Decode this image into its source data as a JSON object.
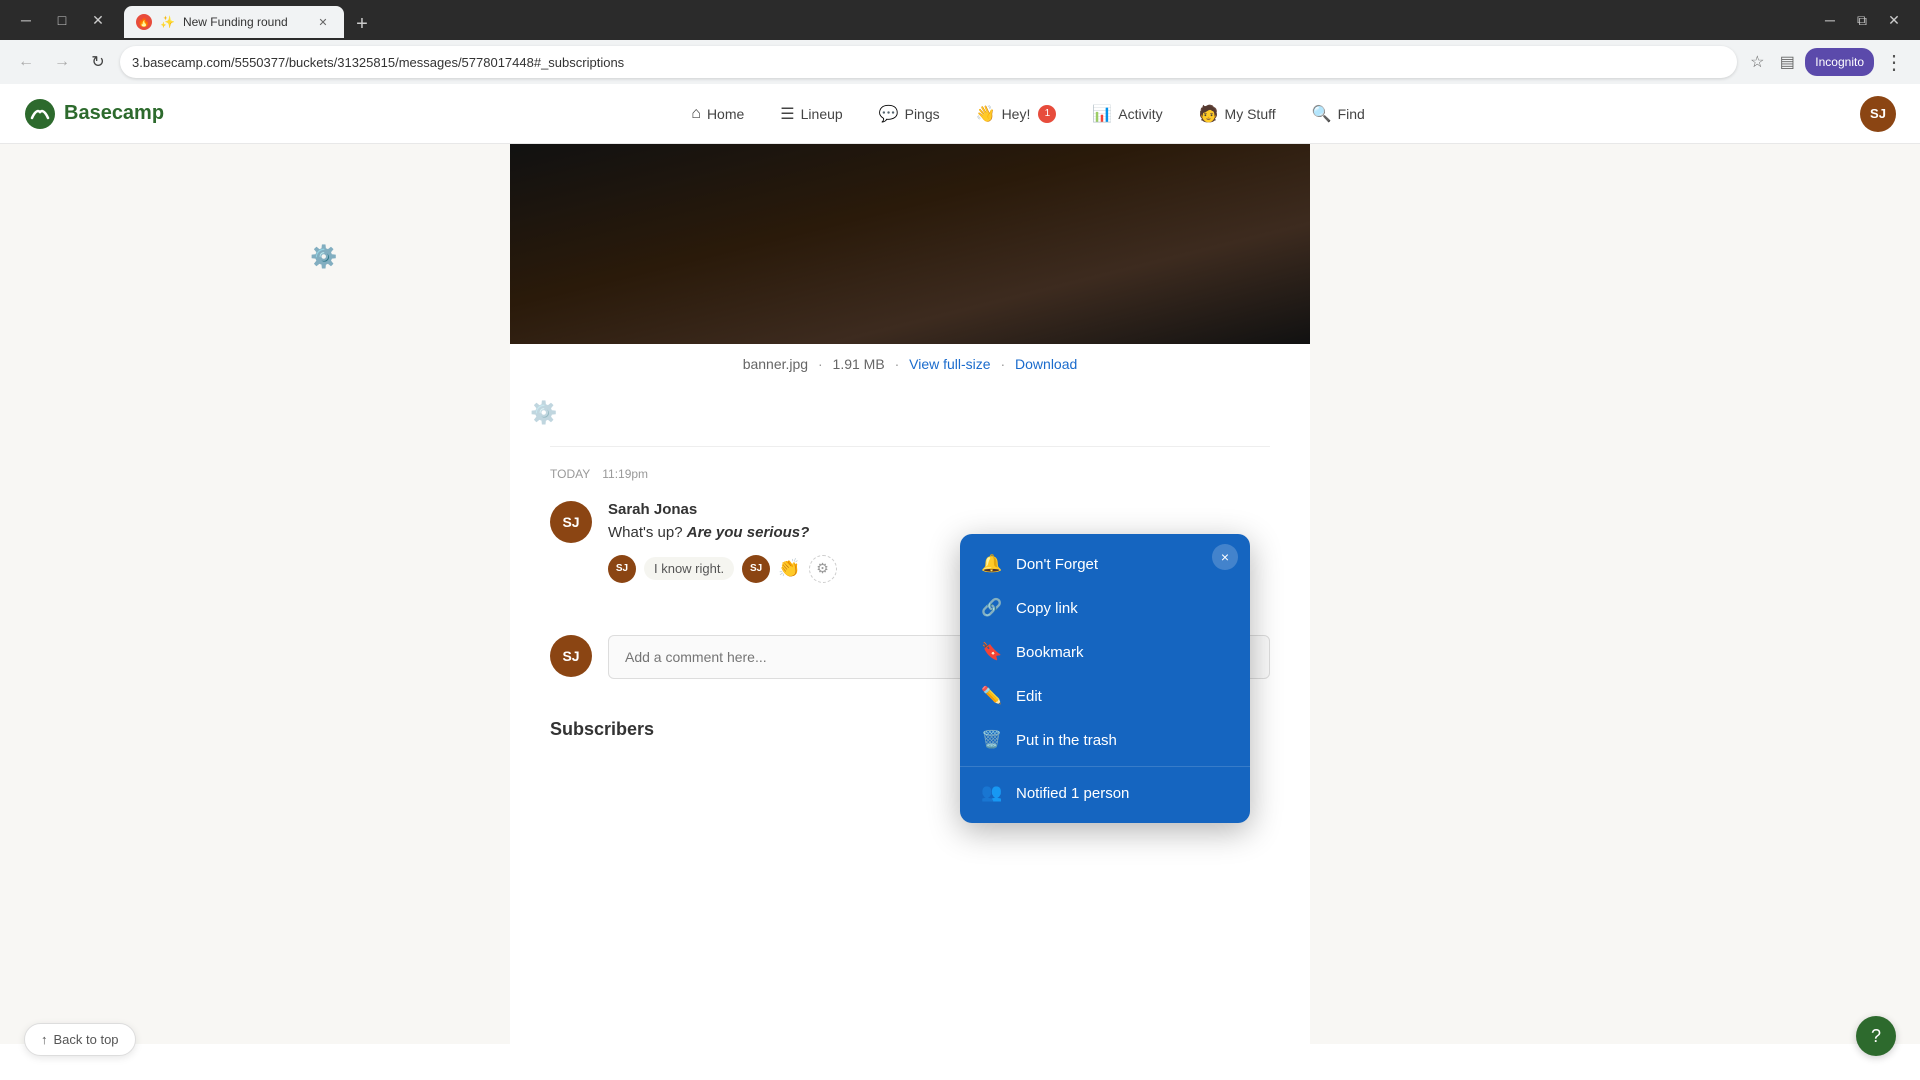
{
  "browser": {
    "tab_title": "New Funding round",
    "tab_favicon": "🔴",
    "url": "3.basecamp.com/5550377/buckets/31325815/messages/5778017448#_subscriptions",
    "new_tab_label": "+",
    "back_label": "←",
    "forward_label": "→",
    "refresh_label": "↻",
    "incognito_label": "Incognito",
    "more_label": "⋮"
  },
  "nav": {
    "logo_text": "Basecamp",
    "home_label": "Home",
    "lineup_label": "Lineup",
    "pings_label": "Pings",
    "hey_label": "Hey!",
    "activity_label": "Activity",
    "mystuff_label": "My Stuff",
    "find_label": "Find",
    "user_initials": "SJ"
  },
  "banner": {
    "filename": "banner.jpg",
    "filesize": "1.91 MB",
    "view_full_size_label": "View full-size",
    "download_label": "Download",
    "separator": "·"
  },
  "comment": {
    "date_label": "TODAY",
    "time_label": "11:19pm",
    "author": "Sarah Jonas",
    "author_initials": "SJ",
    "text_before": "What's up? ",
    "text_italic": "Are you serious?",
    "reaction_initials": "SJ",
    "reaction_text": "I know right.",
    "reaction_emoji": "👏",
    "input_placeholder": "Add a comment here..."
  },
  "context_menu": {
    "dont_forget_label": "Don't Forget",
    "copy_link_label": "Copy link",
    "bookmark_label": "Bookmark",
    "edit_label": "Edit",
    "trash_label": "Put in the trash",
    "notified_label": "Notified 1 person",
    "close_label": "×"
  },
  "subscribers": {
    "title": "Subscribers"
  },
  "back_to_top": {
    "label": "Back to top"
  },
  "help_btn": {
    "label": "?"
  }
}
